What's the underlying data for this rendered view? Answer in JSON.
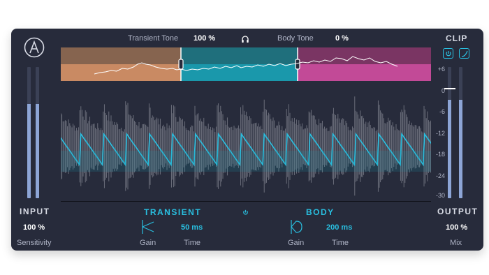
{
  "header": {
    "transient_tone_label": "Transient Tone",
    "transient_tone_value": "100 %",
    "body_tone_label": "Body Tone",
    "body_tone_value": "0 %",
    "clip_label": "CLIP"
  },
  "left": {
    "input_label": "INPUT",
    "sensitivity_value": "100 %",
    "sensitivity_label": "Sensitivity",
    "input_level": 0.72
  },
  "right": {
    "output_label": "OUTPUT",
    "mix_value": "100 %",
    "mix_label": "Mix",
    "output_level_left": 0.75,
    "output_level_right": 0.75,
    "clip_threshold_db": 0
  },
  "db_scale": [
    "+6",
    "0",
    "-6",
    "-12",
    "-18",
    "-24",
    "-30"
  ],
  "bottom": {
    "transient_label": "TRANSIENT",
    "body_label": "BODY",
    "transient_time_value": "50 ms",
    "body_time_value": "200 ms",
    "gain_label": "Gain",
    "time_label": "Time"
  },
  "colors": {
    "background": "#272b3b",
    "accent": "#29bfe0",
    "transient_band": "#c98a63",
    "body_band": "#1a98ab",
    "third_band": "#c24a97"
  }
}
